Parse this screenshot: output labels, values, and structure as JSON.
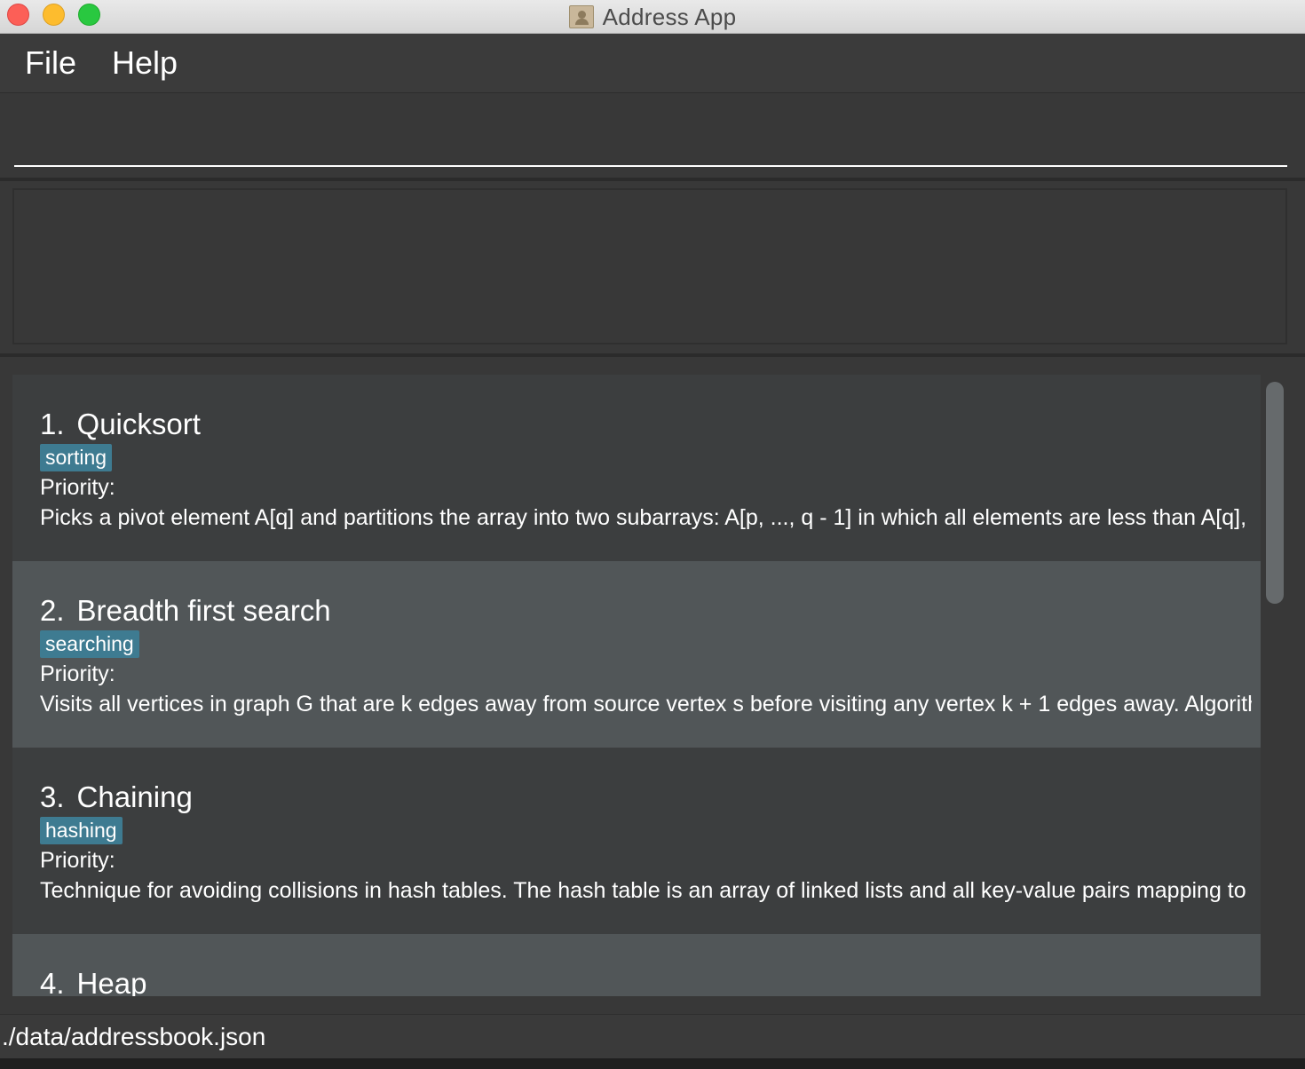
{
  "window": {
    "title": "Address App"
  },
  "menu": {
    "file": "File",
    "help": "Help"
  },
  "command_box": {
    "value": ""
  },
  "result_display": {
    "text": ""
  },
  "cards": [
    {
      "index": "1.",
      "name": "Quicksort",
      "tag": "sorting",
      "priority": "Priority:",
      "description": "Picks a pivot element A[q] and partitions the array into two subarrays: A[p, ..., q - 1] in which all elements are less than A[q], a..."
    },
    {
      "index": "2.",
      "name": "Breadth first search",
      "tag": "searching",
      "priority": "Priority:",
      "description": "Visits all vertices in graph G that are k edges away from source vertex s before visiting any vertex k + 1 edges away. Algorith..."
    },
    {
      "index": "3.",
      "name": "Chaining",
      "tag": "hashing",
      "priority": "Priority:",
      "description": "Technique for avoiding collisions in hash tables. The hash table is an array of linked lists and all key-value pairs mapping to th..."
    },
    {
      "index": "4.",
      "name": "Heap",
      "tag": "",
      "priority": "",
      "description": ""
    }
  ],
  "status_bar": {
    "file_path": "./data/addressbook.json"
  },
  "colors": {
    "background": "#383838",
    "card_odd": "#3c3e3f",
    "card_even": "#515658",
    "tag": "#3e7b91"
  },
  "icons": {
    "window_close": "close-button",
    "window_minimize": "minimize-button",
    "window_maximize": "maximize-button",
    "app": "address-book-icon"
  }
}
